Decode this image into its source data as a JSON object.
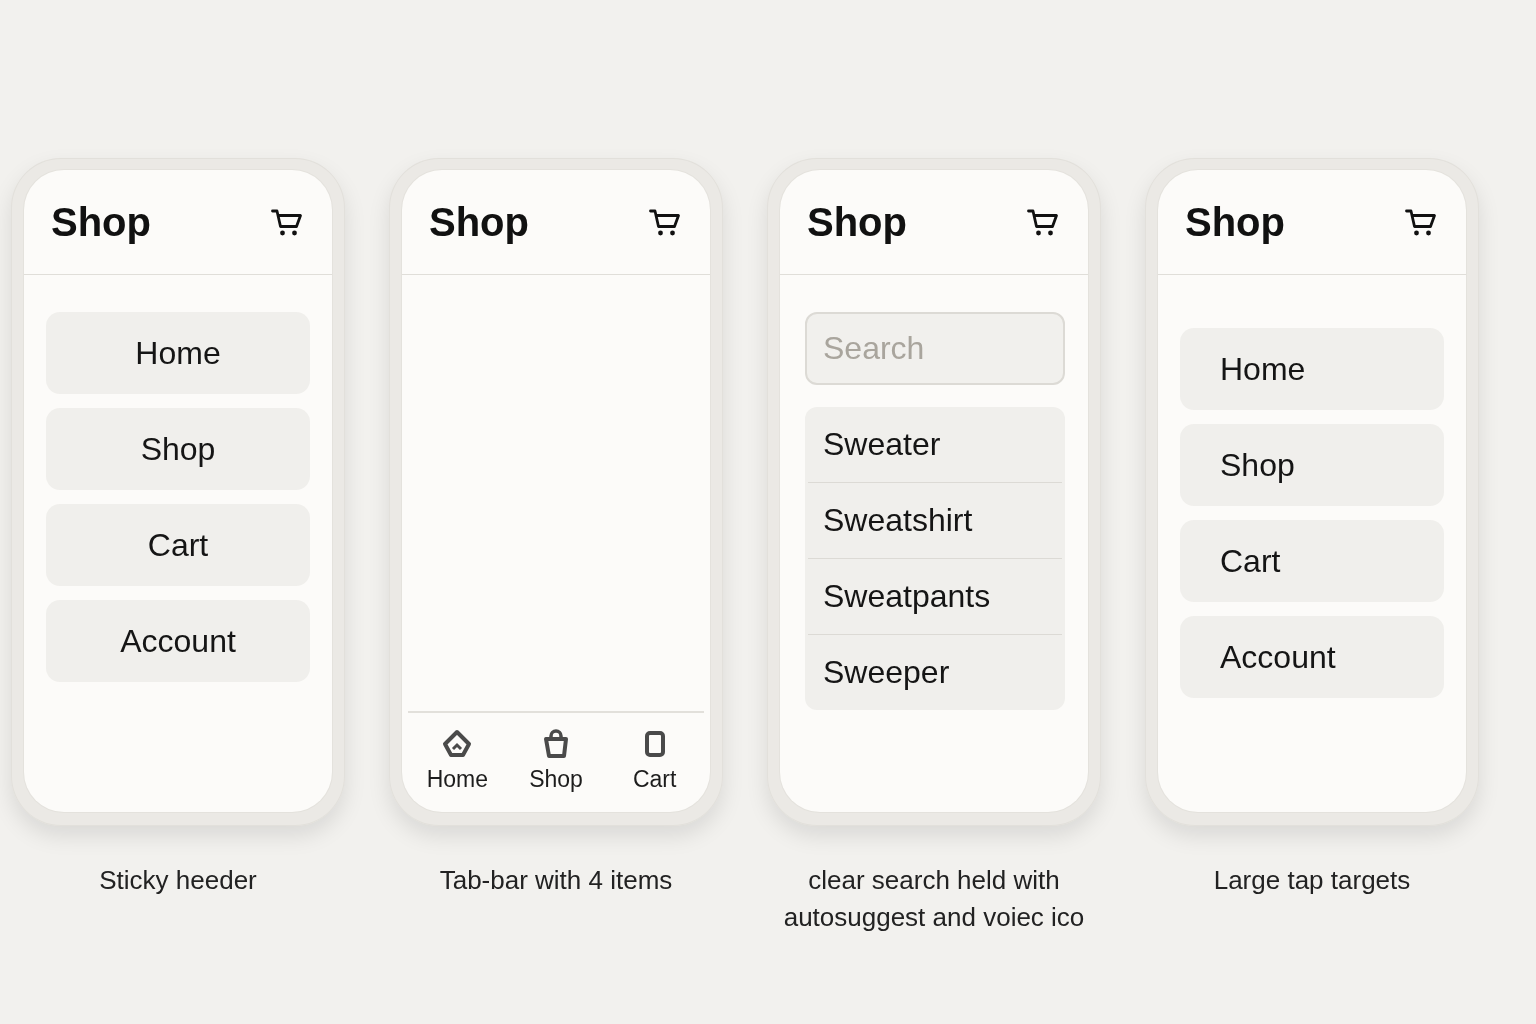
{
  "phones": [
    {
      "kind": "menu",
      "title": "Shop",
      "items": [
        {
          "label": "Home"
        },
        {
          "label": "Shop"
        },
        {
          "label": "Cart"
        },
        {
          "label": "Account"
        }
      ],
      "caption": "Sticky heeder"
    },
    {
      "kind": "tabs",
      "title": "Shop",
      "tabs": [
        {
          "label": "Home"
        },
        {
          "label": "Shop"
        },
        {
          "label": "Cart"
        }
      ],
      "caption": "Tab-bar with 4 items"
    },
    {
      "kind": "search",
      "title": "Shop",
      "search": {
        "placeholder": "Search"
      },
      "suggestions": [
        {
          "label": "Sweater"
        },
        {
          "label": "Sweatshirt"
        },
        {
          "label": "Sweatpants"
        },
        {
          "label": "Sweeper"
        }
      ],
      "caption": "clear search held with\nautosuggest and voiec ico"
    },
    {
      "kind": "targets",
      "title": "Shop",
      "items": [
        {
          "label": "Home"
        },
        {
          "label": "Shop"
        },
        {
          "label": "Cart"
        },
        {
          "label": "Account"
        }
      ],
      "caption": "Large tap targets"
    }
  ]
}
